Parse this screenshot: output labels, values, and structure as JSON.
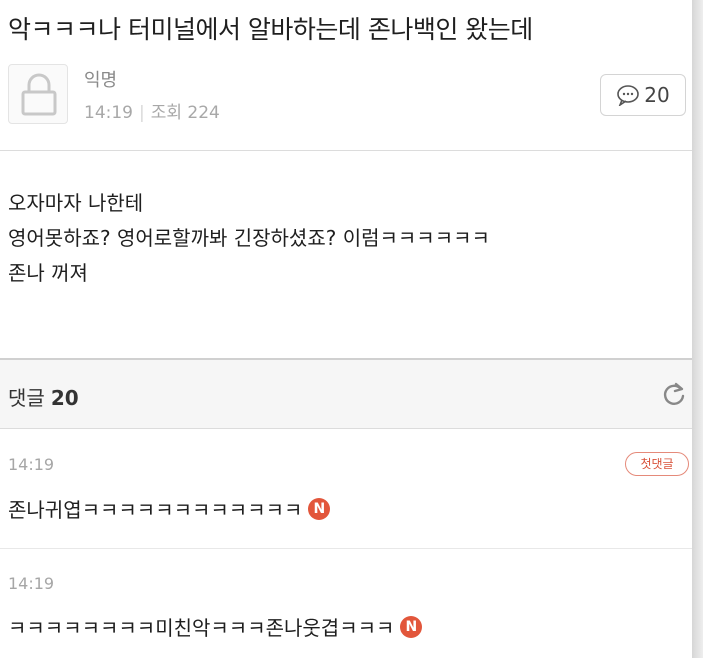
{
  "post": {
    "title": "악ㅋㅋㅋ나 터미널에서 알바하는데 존나백인 왔는데",
    "author": "익명",
    "time": "14:19",
    "views_label": "조회 224",
    "comment_count": "20",
    "body_lines": [
      "오자마자 나한테",
      "영어못하죠? 영어로할까봐 긴장하셨죠? 이럼ㅋㅋㅋㅋㅋㅋ",
      "존나 꺼져"
    ]
  },
  "comments_header": {
    "label": "댓글",
    "count": "20"
  },
  "comments": [
    {
      "time": "14:19",
      "text": "존나귀엽ㅋㅋㅋㅋㅋㅋㅋㅋㅋㅋㅋㅋ",
      "badge": "첫댓글",
      "new_mark": "N"
    },
    {
      "time": "14:19",
      "text": "ㅋㅋㅋㅋㅋㅋㅋㅋ미친악ㅋㅋㅋ존나웃겹ㅋㅋㅋ",
      "new_mark": "N"
    }
  ],
  "icons": {
    "avatar": "lock-avatar-icon",
    "comment": "speech-bubble-icon",
    "refresh": "refresh-icon"
  },
  "colors": {
    "new_badge": "#e2563b",
    "first_comment_badge": "#d9533b"
  }
}
